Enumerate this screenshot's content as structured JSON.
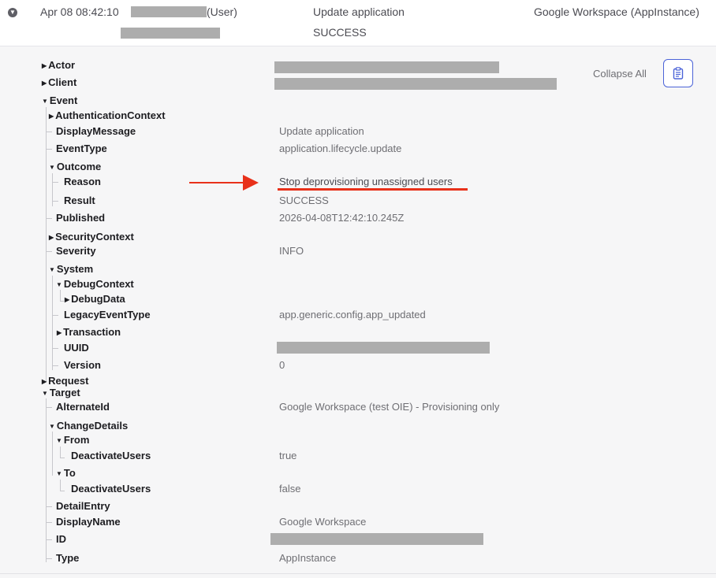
{
  "header": {
    "date": "Apr 08 08:42:10",
    "actor_suffix": "(User)",
    "event_title": "Update application",
    "outcome": "SUCCESS",
    "target": "Google Workspace  (AppInstance)"
  },
  "toolbar": {
    "collapse_all": "Collapse All"
  },
  "tree": {
    "actor": "Actor",
    "client": "Client",
    "event": "Event",
    "authentication_context": "AuthenticationContext",
    "display_message": "DisplayMessage",
    "display_message_value": "Update application",
    "event_type": "EventType",
    "event_type_value": "application.lifecycle.update",
    "outcome": "Outcome",
    "reason": "Reason",
    "reason_value": "Stop deprovisioning unassigned users",
    "result": "Result",
    "result_value": "SUCCESS",
    "published": "Published",
    "published_value": "2026-04-08T12:42:10.245Z",
    "security_context": "SecurityContext",
    "severity": "Severity",
    "severity_value": "INFO",
    "system": "System",
    "debug_context": "DebugContext",
    "debug_data": "DebugData",
    "legacy_event_type": "LegacyEventType",
    "legacy_event_type_value": "app.generic.config.app_updated",
    "transaction": "Transaction",
    "uuid": "UUID",
    "version": "Version",
    "version_value": "0",
    "request": "Request",
    "target": "Target",
    "alternate_id": "AlternateId",
    "alternate_id_value": "Google Workspace (test OIE) - Provisioning only",
    "change_details": "ChangeDetails",
    "from": "From",
    "deactivate_users_from": "DeactivateUsers",
    "deactivate_users_from_value": "true",
    "to": "To",
    "deactivate_users_to": "DeactivateUsers",
    "deactivate_users_to_value": "false",
    "detail_entry": "DetailEntry",
    "display_name": "DisplayName",
    "display_name_value": "Google Workspace",
    "id": "ID",
    "type": "Type",
    "type_value": "AppInstance"
  },
  "colors": {
    "annotation_red": "#e8311a",
    "accent_blue": "#4b63d8",
    "redaction_gray": "#adadad"
  }
}
